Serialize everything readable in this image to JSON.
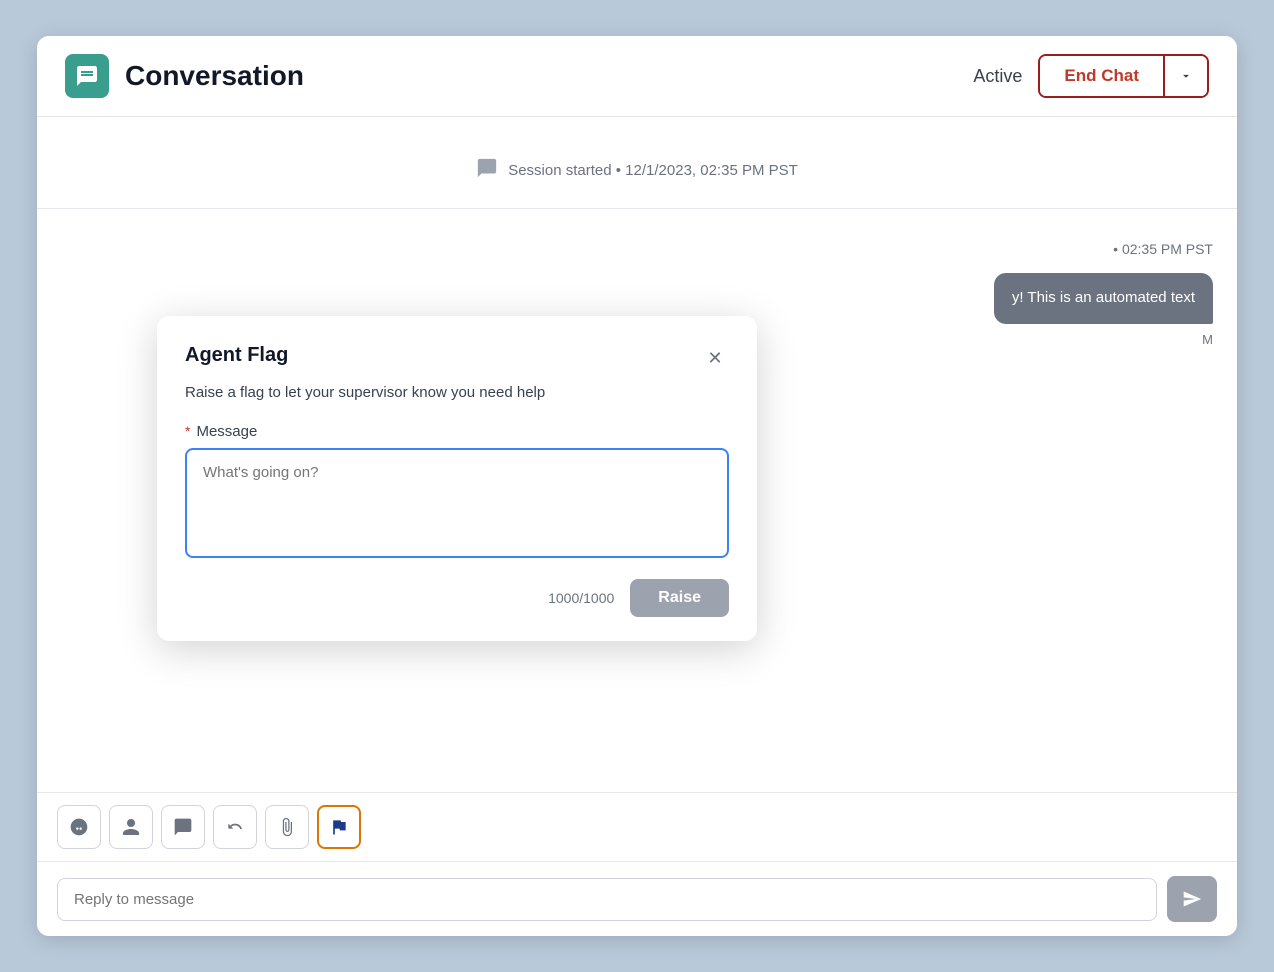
{
  "header": {
    "title": "Conversation",
    "status": "Active",
    "end_chat_label": "End Chat"
  },
  "session": {
    "text": "Session started • 12/1/2023, 02:35 PM PST"
  },
  "messages": [
    {
      "time": "• 02:35 PM PST",
      "bubble": "y! This is an automated text",
      "sender": "M"
    }
  ],
  "toolbar": {
    "buttons": [
      "emoji",
      "person",
      "chat",
      "undo",
      "paperclip",
      "flag"
    ]
  },
  "reply": {
    "placeholder": "Reply to message"
  },
  "modal": {
    "title": "Agent Flag",
    "description": "Raise a flag to let your supervisor know you need help",
    "label": "Message",
    "textarea_placeholder": "What's going on?",
    "char_count": "1000/1000",
    "raise_label": "Raise"
  }
}
